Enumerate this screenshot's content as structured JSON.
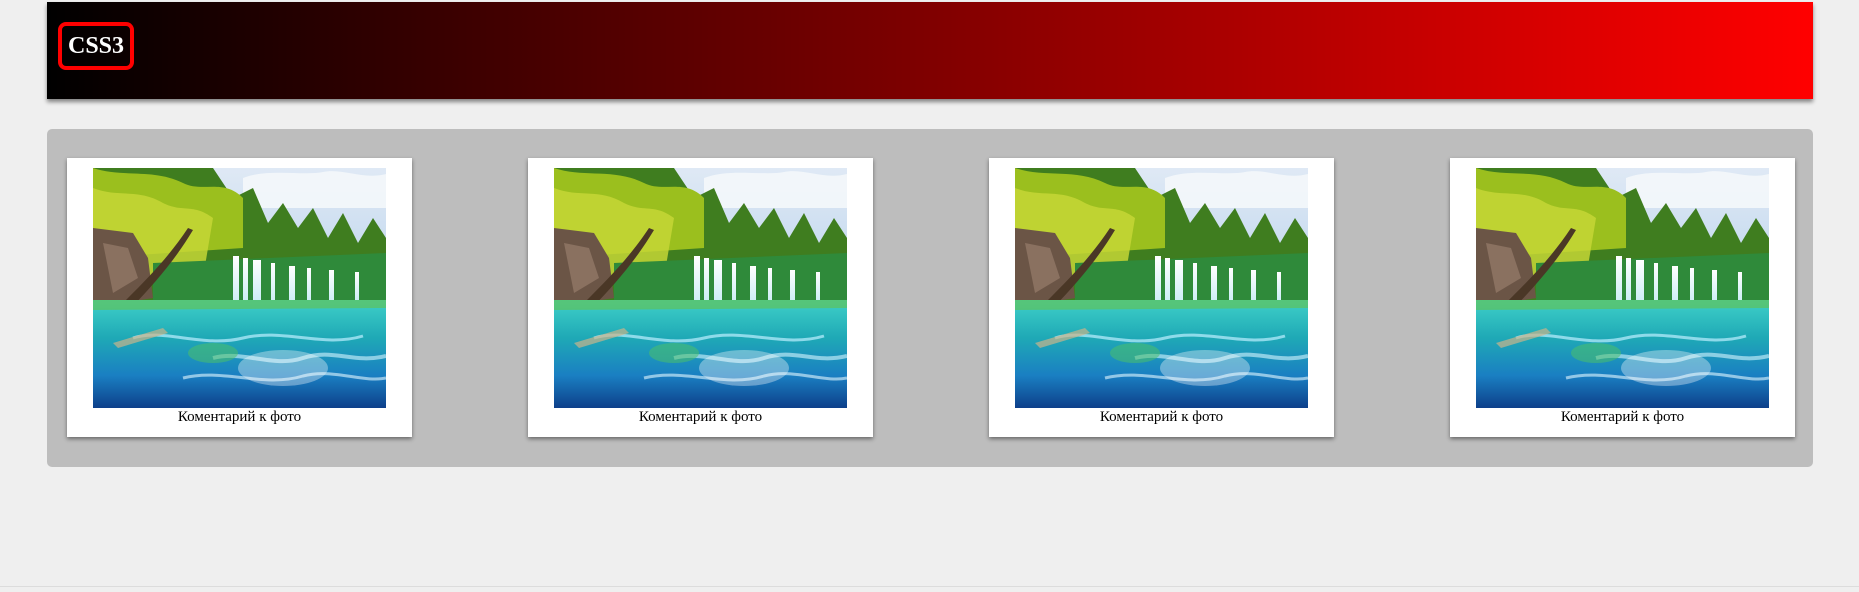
{
  "header": {
    "logo": "CSS3",
    "gradient_start": "#000000",
    "gradient_end": "#ff0000",
    "logo_border_color": "#ff0000"
  },
  "gallery": {
    "background": "#bdbdbd",
    "items": [
      {
        "caption": "Коментарий к фото",
        "image": "waterfall-lake-photo"
      },
      {
        "caption": "Коментарий к фото",
        "image": "waterfall-lake-photo"
      },
      {
        "caption": "Коментарий к фото",
        "image": "waterfall-lake-photo"
      },
      {
        "caption": "Коментарий к фото",
        "image": "waterfall-lake-photo"
      }
    ]
  }
}
